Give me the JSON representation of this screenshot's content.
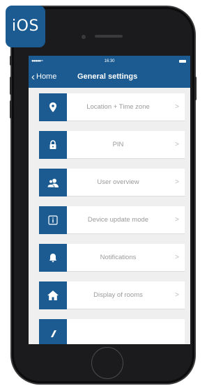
{
  "badge": {
    "label": "iOS"
  },
  "status_bar": {
    "signal": "●●●●● ≈",
    "time": "16:30"
  },
  "nav": {
    "back_label": "Home",
    "title": "General settings"
  },
  "menu": {
    "items": [
      {
        "label": "Location + Time zone",
        "icon": "location-pin-icon"
      },
      {
        "label": "PIN",
        "icon": "lock-icon"
      },
      {
        "label": "User overview",
        "icon": "users-icon"
      },
      {
        "label": "Device update mode",
        "icon": "info-icon"
      },
      {
        "label": "Notifications",
        "icon": "bell-icon"
      },
      {
        "label": "Display of rooms",
        "icon": "house-icon"
      },
      {
        "label": "",
        "icon": "partial-icon"
      }
    ],
    "chevron": ">"
  },
  "colors": {
    "brand_blue": "#1b5b91",
    "background": "#efefef",
    "label_gray": "#9a9a9a"
  }
}
